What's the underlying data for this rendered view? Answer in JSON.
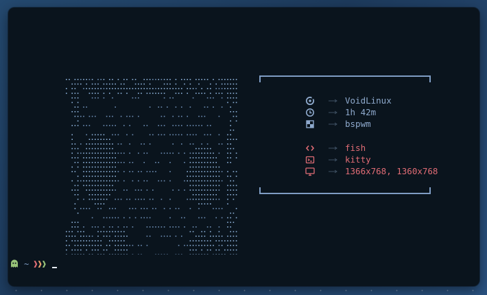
{
  "wallpaper": {
    "color": "#24496f"
  },
  "terminal": {
    "background": "#0a141d",
    "info": {
      "rows": [
        {
          "icon": "void-linux-logo-icon",
          "value": "VoidLinux",
          "color": "#8ea9cc"
        },
        {
          "icon": "clock-icon",
          "value": "1h 42m",
          "color": "#8ea9cc"
        },
        {
          "icon": "window-manager-icon",
          "value": "bspwm",
          "color": "#8ea9cc"
        },
        {
          "icon": "code-brackets-icon",
          "value": "fish",
          "color": "#e06c75"
        },
        {
          "icon": "terminal-icon",
          "value": "kitty",
          "color": "#e06c75"
        },
        {
          "icon": "monitor-icon",
          "value": "1366x768, 1360x768",
          "color": "#e06c75"
        }
      ]
    },
    "prompt": {
      "ghost_icon": "ghost-icon",
      "path": "~",
      "symbol": "❱❱❱",
      "colors": [
        "#e06c75",
        "#e5a06a",
        "#98c379"
      ]
    }
  }
}
